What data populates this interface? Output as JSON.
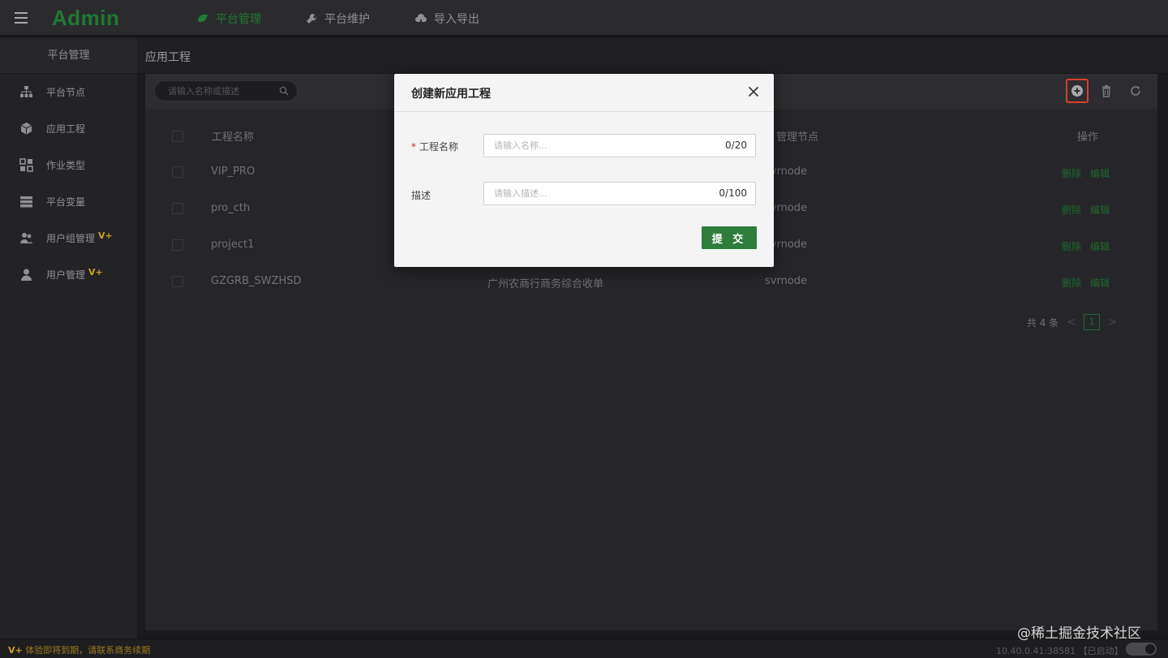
{
  "app": {
    "brand": "Admin"
  },
  "topnav": [
    {
      "label": "平台管理",
      "icon": "leaf-icon",
      "active": true
    },
    {
      "label": "平台维护",
      "icon": "wrench-icon",
      "active": false
    },
    {
      "label": "导入导出",
      "icon": "cloud-icon",
      "active": false
    }
  ],
  "sidebar": {
    "header": "平台管理",
    "items": [
      {
        "label": "平台节点",
        "icon": "sitemap-icon"
      },
      {
        "label": "应用工程",
        "icon": "cube-icon"
      },
      {
        "label": "作业类型",
        "icon": "grid-icon"
      },
      {
        "label": "平台变量",
        "icon": "server-icon"
      },
      {
        "label": "用户组管理",
        "icon": "users-icon",
        "badge": "V+"
      },
      {
        "label": "用户管理",
        "icon": "user-icon",
        "badge": "V+"
      }
    ]
  },
  "page": {
    "title": "应用工程"
  },
  "search": {
    "placeholder": "请输入名称或描述"
  },
  "table": {
    "headers": {
      "name": "工程名称",
      "node": "管理节点",
      "ops": "操作"
    },
    "rows": [
      {
        "name": "VIP_PRO",
        "desc": "",
        "node": "svrnode",
        "delete": "删除",
        "edit": "编辑"
      },
      {
        "name": "pro_cth",
        "desc": "",
        "node": "svrnode",
        "delete": "删除",
        "edit": "编辑"
      },
      {
        "name": "project1",
        "desc": "",
        "node": "svrnode",
        "delete": "删除",
        "edit": "编辑"
      },
      {
        "name": "GZGRB_SWZHSD",
        "desc": "广州农商行商务综合收单",
        "node": "svrnode",
        "delete": "删除",
        "edit": "编辑"
      }
    ]
  },
  "pager": {
    "total": "共 4 条",
    "prev": "<",
    "page": "1",
    "next": ">"
  },
  "modal": {
    "title": "创建新应用工程",
    "name_label": "工程名称",
    "name_required": "*",
    "name_placeholder": "请输入名称...",
    "name_counter": "0/20",
    "desc_label": "描述",
    "desc_placeholder": "请输入描述...",
    "desc_counter": "0/100",
    "submit": "提 交"
  },
  "footer": {
    "badge": "V+",
    "warning": "体验即将到期，请联系商务续期",
    "server": "10.40.0.41:38581 【已启动】"
  },
  "watermark": "@稀土掘金技术社区",
  "colors": {
    "accent": "#2e7d3a",
    "highlight": "#d8402c",
    "warning": "#c9a227"
  }
}
